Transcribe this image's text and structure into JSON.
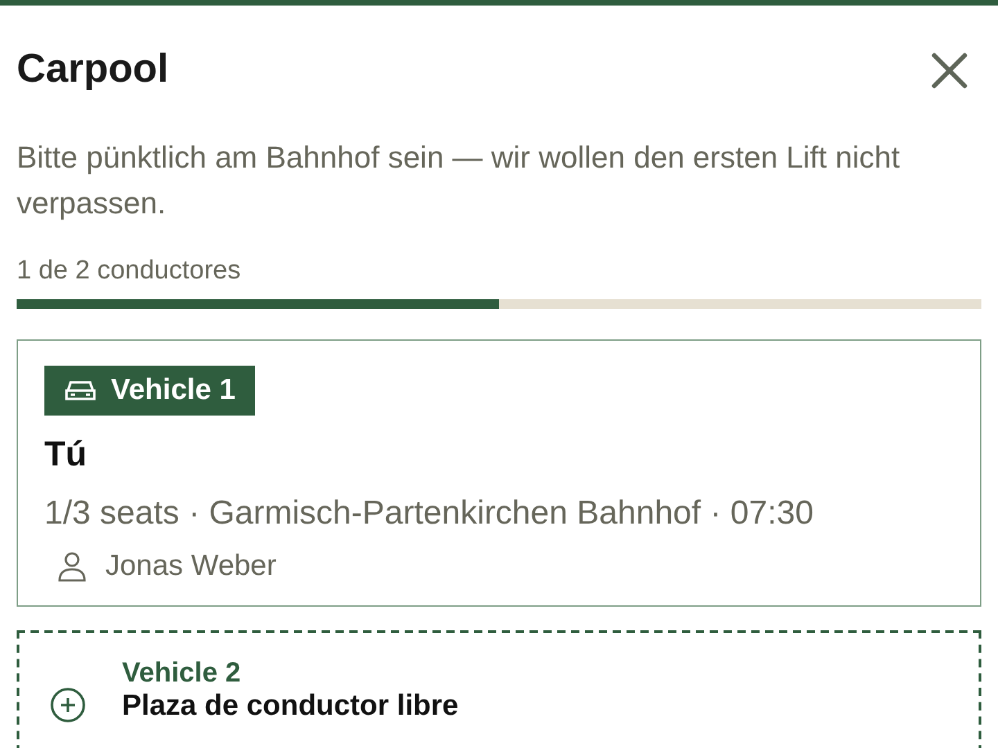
{
  "header": {
    "title": "Carpool"
  },
  "description": "Bitte pünktlich am Bahnhof sein — wir wollen den ersten Lift nicht verpassen.",
  "progress": {
    "label": "1 de 2 conductores",
    "level": 0.5
  },
  "vehicles": [
    {
      "kind": "assigned",
      "label": "Vehicle 1",
      "driver": "Tú",
      "details": "1/3 seats · Garmisch-Partenkirchen Bahnhof · 07:30",
      "passengers": [
        "Jonas Weber"
      ]
    },
    {
      "kind": "open",
      "label": "Vehicle 2",
      "status": "Plaza de conductor libre"
    }
  ]
}
